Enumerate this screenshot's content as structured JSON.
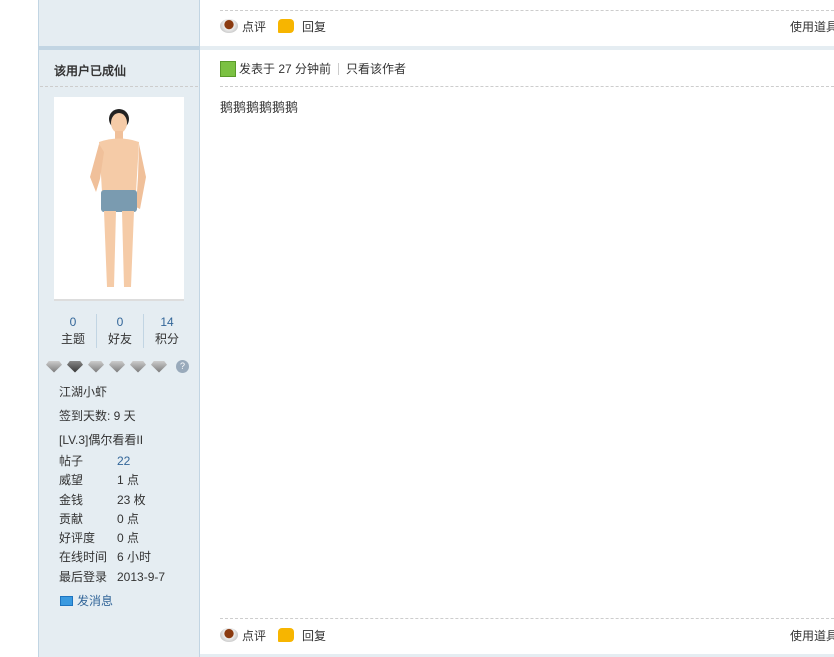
{
  "prev_post": {
    "rate_label": "点评",
    "reply_label": "回复",
    "tools_label": "使用道具"
  },
  "author": {
    "name": "该用户已成仙",
    "stats": [
      {
        "value": "0",
        "label": "主题"
      },
      {
        "value": "0",
        "label": "好友"
      },
      {
        "value": "14",
        "label": "积分"
      }
    ],
    "title": "江湖小虾",
    "checkin": "签到天数: 9 天",
    "level": "[LV.3]偶尔看看II",
    "details": [
      {
        "k": "帖子",
        "v": "22"
      },
      {
        "k": "威望",
        "v": "1 点"
      },
      {
        "k": "金钱",
        "v": "23 枚"
      },
      {
        "k": "贡献",
        "v": "0 点"
      },
      {
        "k": "好评度",
        "v": "0 点"
      },
      {
        "k": "在线时间",
        "v": "6 小时"
      },
      {
        "k": "最后登录",
        "v": "2013-9-7"
      }
    ],
    "send_message": "发消息",
    "medal_help": "?"
  },
  "post": {
    "posted": "发表于 27 分钟前",
    "only_author": "只看该作者",
    "content": "鹅鹅鹅鹅鹅鹅",
    "rate_label": "点评",
    "reply_label": "回复",
    "tools_label": "使用道具"
  }
}
